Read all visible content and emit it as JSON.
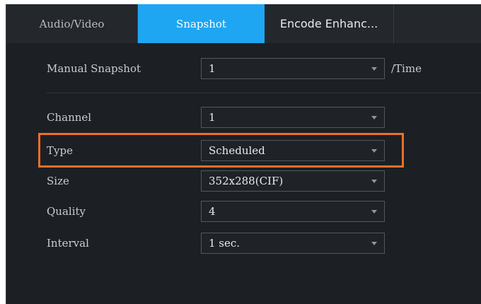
{
  "tabs": [
    {
      "label": "Audio/Video"
    },
    {
      "label": "Snapshot"
    },
    {
      "label": "Encode Enhanc..."
    },
    {
      "label": ""
    }
  ],
  "manual_snapshot": {
    "label": "Manual Snapshot",
    "value": "1",
    "unit": "/Time"
  },
  "fields": {
    "channel": {
      "label": "Channel",
      "value": "1"
    },
    "type": {
      "label": "Type",
      "value": "Scheduled"
    },
    "size": {
      "label": "Size",
      "value": "352x288(CIF)"
    },
    "quality": {
      "label": "Quality",
      "value": "4"
    },
    "interval": {
      "label": "Interval",
      "value": "1 sec."
    }
  },
  "colors": {
    "active_tab": "#1ea6f3",
    "highlight": "#f06e2a",
    "background": "#1c2024"
  }
}
